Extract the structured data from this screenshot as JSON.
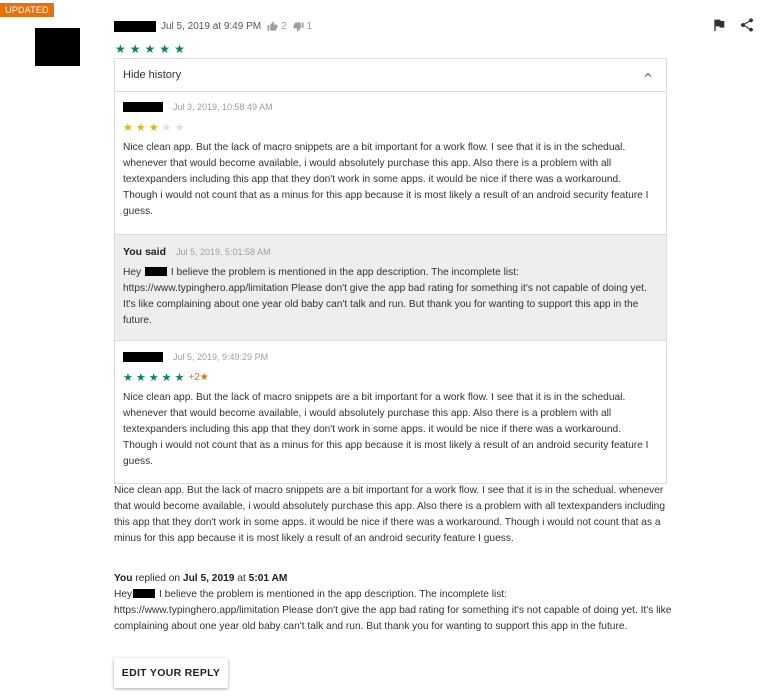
{
  "badge": "UPDATED",
  "review": {
    "date": "Jul 5, 2019 at 9:49 PM",
    "thumbs_up_count": "2",
    "thumbs_down_count": "1",
    "rating": 5
  },
  "history": {
    "toggle_label": "Hide history",
    "entries": [
      {
        "timestamp": "Jul 3, 2019, 10:58:49 AM",
        "rating": 3,
        "text": "Nice clean app. But the lack of macro snippets are a bit important for a work flow. I see that it is in the schedual. whenever that would become available, i would absolutely purchase this app. Also there is a problem with all textexpanders including this app that they don't work in some apps. it would be nice if there was a workaround. Though i would not count that as a minus for this app because it is most likely a result of an android security feature I guess."
      },
      {
        "label": "You said",
        "timestamp": "Jul 5, 2019, 5:01:58 AM",
        "text_start": "Hey",
        "text_rest": "I believe the problem is mentioned in the app description. The incomplete list: https://www.typinghero.app/limitation Please don't give the app bad rating for something it's not capable of doing yet. It's like complaining about one year old baby can't talk and run. But thank you for wanting to support this app in the future."
      },
      {
        "timestamp": "Jul 5, 2019, 9:49:29 PM",
        "rating": 5,
        "rating_change": "+2★",
        "text": "Nice clean app. But the lack of macro snippets are a bit important for a work flow. I see that it is in the schedual. whenever that would become available, i would absolutely purchase this app. Also there is a problem with all textexpanders including this app that they don't work in some apps. it would be nice if there was a workaround. Though i would not count that as a minus for this app because it is most likely a result of an android security feature I guess."
      }
    ]
  },
  "current_text": "Nice clean app. But the lack of macro snippets are a bit important for a work flow. I see that it is in the schedual. whenever that would become available, i would absolutely purchase this app. Also there is a problem with all textexpanders including this app that they don't work in some apps. it would be nice if there was a workaround. Though i would not count that as a minus for this app because it is most likely a result of an android security feature I guess.",
  "reply": {
    "author": "You",
    "replied_on": "replied on",
    "date": "Jul 5, 2019",
    "at": "at",
    "time": "5:01 AM",
    "text_start": "Hey",
    "text_rest": "I believe the problem is mentioned in the app description. The incomplete list: https://www.typinghero.app/limitation Please don't give the app bad rating for something it's not capable of doing yet. It's like complaining about one year old baby can't talk and run. But thank you for wanting to support this app in the future."
  },
  "edit_button_label": "EDIT YOUR REPLY",
  "icons": {
    "flag": "flag-icon",
    "share": "share-icon",
    "thumbs_up": "thumbs-up-icon",
    "thumbs_down": "thumbs-down-icon",
    "chevron": "chevron-up-icon",
    "star": "★"
  },
  "colors": {
    "badge": "#e8710a",
    "star_green": "#01875f",
    "star_gold": "#e8b400",
    "star_empty": "#e0e0e0"
  }
}
